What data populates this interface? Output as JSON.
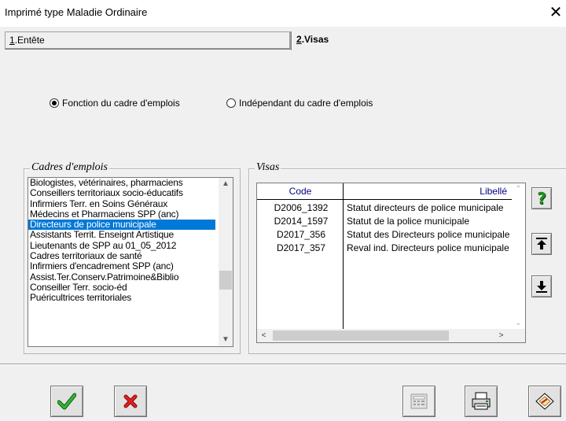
{
  "window": {
    "title": "Imprimé type Maladie Ordinaire",
    "close": "✕"
  },
  "tabs": [
    {
      "num": "1",
      "rest": ".Entête"
    },
    {
      "num": "2",
      "rest": ".Visas"
    }
  ],
  "radios": [
    {
      "label": "Fonction du cadre d'emplois",
      "checked": true
    },
    {
      "label": "Indépendant du cadre d'emplois",
      "checked": false
    }
  ],
  "cadres": {
    "label": "Cadres d'emplois",
    "items": [
      "Biologistes, vétérinaires, pharmaciens",
      "Conseillers territoriaux socio-éducatifs",
      "Infirmiers Terr. en Soins Généraux",
      "Médecins et Pharmaciens SPP (anc)",
      "Directeurs de police municipale",
      "Assistants Territ. Enseignt Artistique",
      "Lieutenants de SPP au 01_05_2012",
      "Cadres territoriaux de santé",
      "Infirmiers d'encadrement SPP (anc)",
      "Assist.Ter.Conserv.Patrimoine&Biblio",
      "Conseiller Terr. socio-éd",
      "Puéricultrices territoriales"
    ],
    "selected_index": 4
  },
  "visas": {
    "label": "Visas",
    "columns": {
      "code": "Code",
      "libelle": "Libellé"
    },
    "rows": [
      {
        "code": "D2006_1392",
        "libelle": "Statut directeurs de police municipale"
      },
      {
        "code": "D2014_1597",
        "libelle": "Statut de la police municipale"
      },
      {
        "code": "D2017_356",
        "libelle": "Statut des Directeurs police municipale"
      },
      {
        "code": "D2017_357",
        "libelle": "Reval ind. Directeurs police municipale"
      }
    ]
  },
  "side_buttons": {
    "help": "?"
  },
  "icons": {
    "help": "help-question-icon",
    "move_up": "move-up-arrow-icon",
    "move_down": "move-down-arrow-icon",
    "validate": "green-checkmark-icon",
    "cancel": "red-cross-icon",
    "calculator": "calculator-icon",
    "print": "printer-icon",
    "edit": "edit-document-icon"
  },
  "colors": {
    "selection": "#0078d7",
    "help": "#2e9e2e",
    "check": "#2aa52a",
    "cross": "#d01a1a",
    "header_text": "#00007f"
  }
}
